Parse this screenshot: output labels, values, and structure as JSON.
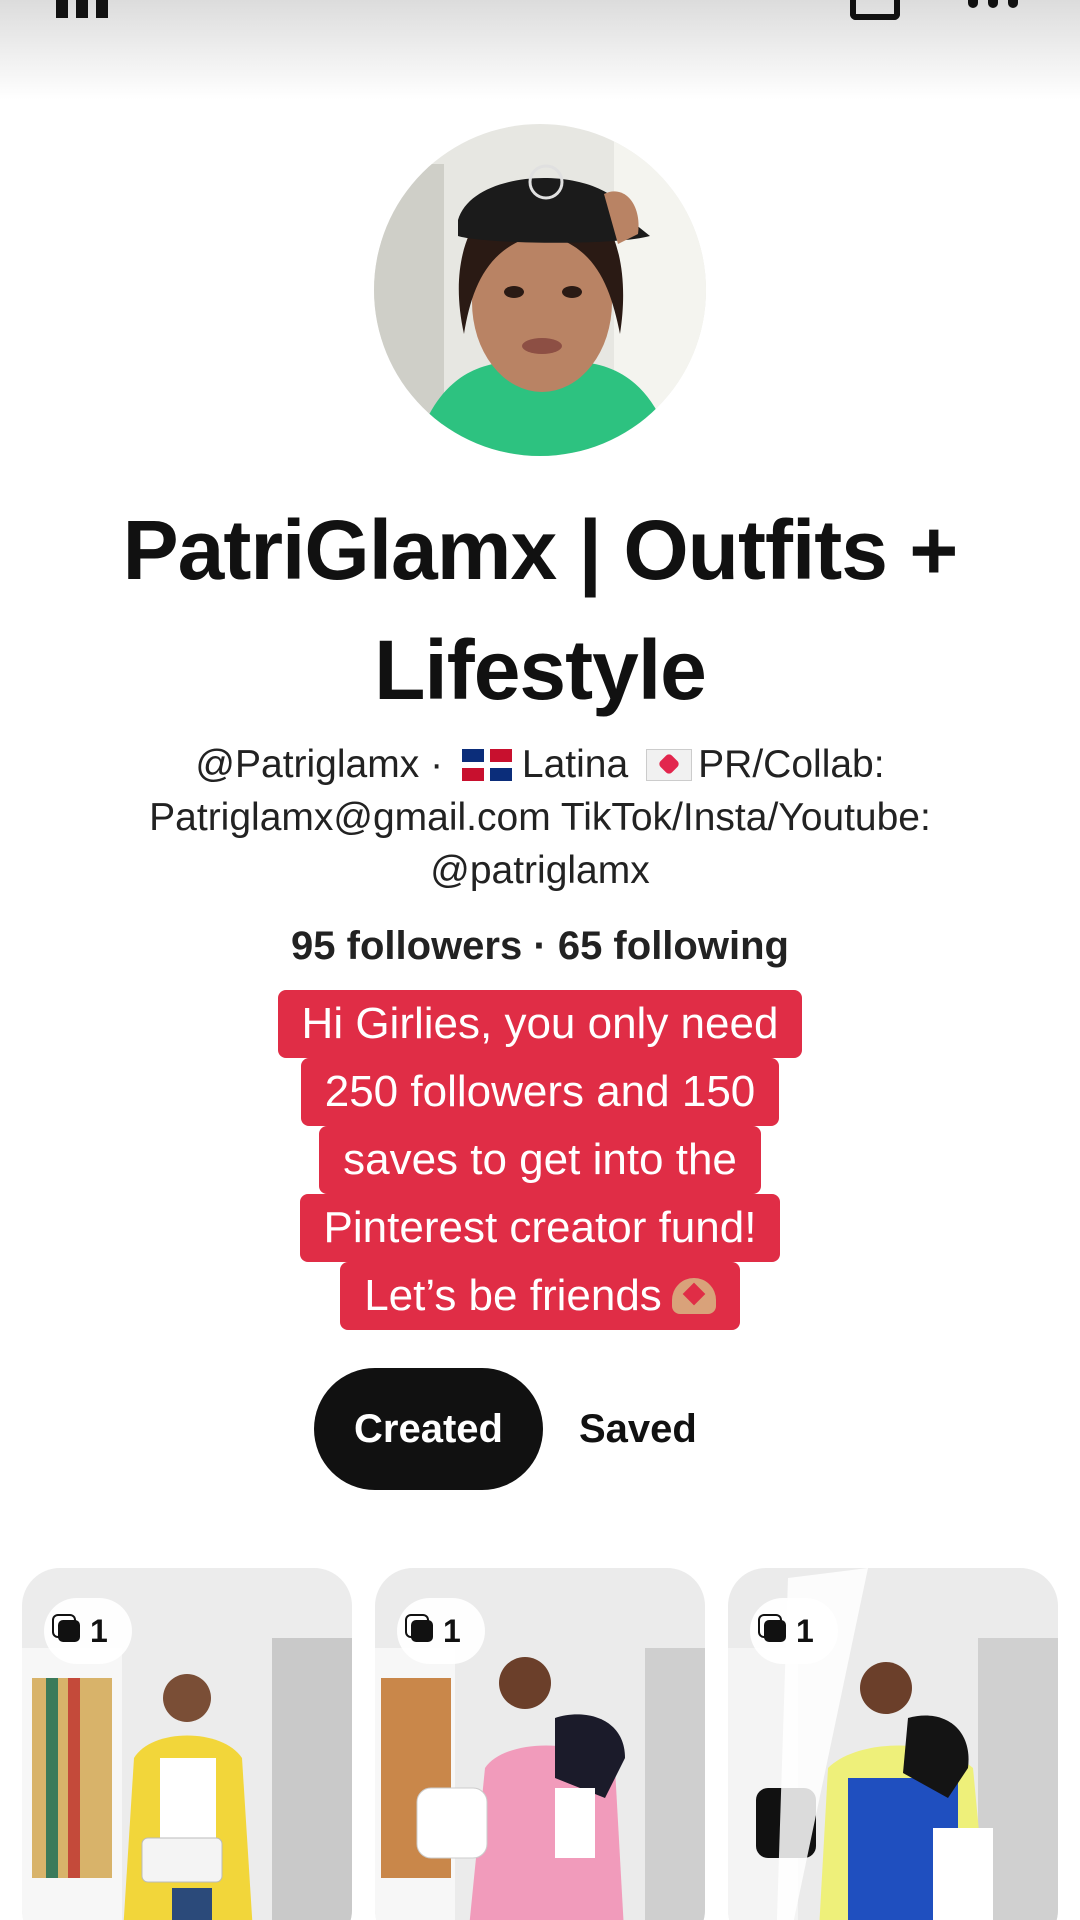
{
  "profile": {
    "name": "PatriGlamx | Outfits + Lifestyle",
    "handle": "@Patriglamx",
    "separator": "·",
    "bio_latina": "Latina",
    "bio_pr": "PR/Collab:",
    "bio_email": "Patriglamx@gmail.com",
    "bio_social": "TikTok/Insta/Youtube:",
    "bio_social_handle": "@patriglamx",
    "followers": "95 followers",
    "stats_separator": "·",
    "following": "65 following"
  },
  "caption": {
    "lines": [
      "Hi Girlies,  you only need",
      "250 followers and 150",
      "saves to get into the",
      "Pinterest creator fund!",
      "Let’s be friends"
    ],
    "background": "#e02d46"
  },
  "tabs": [
    {
      "label": "Created",
      "active": true
    },
    {
      "label": "Saved",
      "active": false
    }
  ],
  "pins": [
    {
      "count": "1"
    },
    {
      "count": "1"
    },
    {
      "count": "1"
    }
  ],
  "icons": {
    "top_left": "library-icon",
    "top_share": "share-icon",
    "top_more": "more-icon",
    "pin_badge": "stack-icon"
  }
}
